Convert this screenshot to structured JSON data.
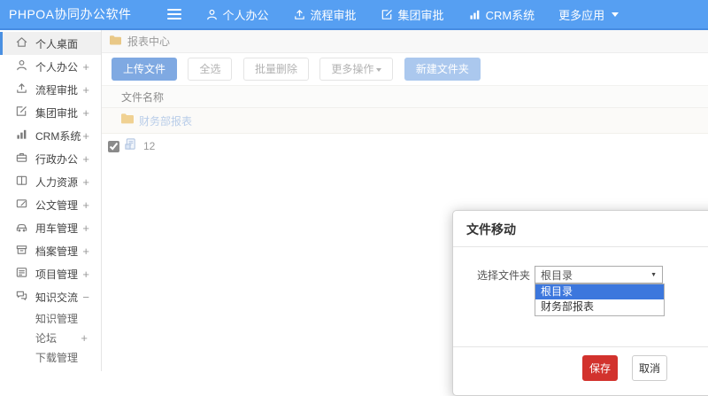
{
  "navbar": {
    "brand": "PHPOA协同办公软件",
    "menu": [
      {
        "label": "个人办公",
        "icon": "person-icon"
      },
      {
        "label": "流程审批",
        "icon": "upload-icon"
      },
      {
        "label": "集团审批",
        "icon": "edit-icon"
      },
      {
        "label": "CRM系统",
        "icon": "chart-icon"
      },
      {
        "label": "更多应用",
        "icon": "caret-down-icon"
      }
    ]
  },
  "sidebar": {
    "items": [
      {
        "label": "个人桌面",
        "icon": "home-icon",
        "suffix": ""
      },
      {
        "label": "个人办公",
        "icon": "person-icon",
        "suffix": "+"
      },
      {
        "label": "流程审批",
        "icon": "upload-icon",
        "suffix": "+"
      },
      {
        "label": "集团审批",
        "icon": "edit-icon",
        "suffix": "+"
      },
      {
        "label": "CRM系统",
        "icon": "chart-icon",
        "suffix": "+"
      },
      {
        "label": "行政办公",
        "icon": "briefcase-icon",
        "suffix": "+"
      },
      {
        "label": "人力资源",
        "icon": "book-icon",
        "suffix": "+"
      },
      {
        "label": "公文管理",
        "icon": "document-icon",
        "suffix": "+"
      },
      {
        "label": "用车管理",
        "icon": "car-icon",
        "suffix": "+"
      },
      {
        "label": "档案管理",
        "icon": "archive-icon",
        "suffix": "+"
      },
      {
        "label": "项目管理",
        "icon": "project-icon",
        "suffix": "+"
      },
      {
        "label": "知识交流",
        "icon": "chat-icon",
        "suffix": "−"
      }
    ],
    "subitems": [
      {
        "label": "知识管理",
        "suffix": ""
      },
      {
        "label": "论坛",
        "suffix": "+"
      },
      {
        "label": "下载管理",
        "suffix": ""
      }
    ]
  },
  "breadcrumb": {
    "label": "报表中心"
  },
  "toolbar": {
    "upload": "上传文件",
    "select_all": "全选",
    "batch_delete": "批量删除",
    "more_actions": "更多操作",
    "new_folder": "新建文件夹"
  },
  "table": {
    "name_header": "文件名称",
    "folder_row": {
      "name": "财务部报表"
    },
    "file_row": {
      "name": "12",
      "checked": true
    }
  },
  "modal": {
    "title": "文件移动",
    "field_label": "选择文件夹",
    "selected_value": "根目录",
    "options": [
      "根目录",
      "财务部报表"
    ],
    "save_label": "保存",
    "cancel_label": "取消"
  },
  "colors": {
    "navbar_blue": "#569ff2",
    "primary_button_blue": "#7fa9e2",
    "save_red": "#d2322d",
    "option_highlight_blue": "#3c77dd",
    "folder_yellow": "#f0d192"
  }
}
